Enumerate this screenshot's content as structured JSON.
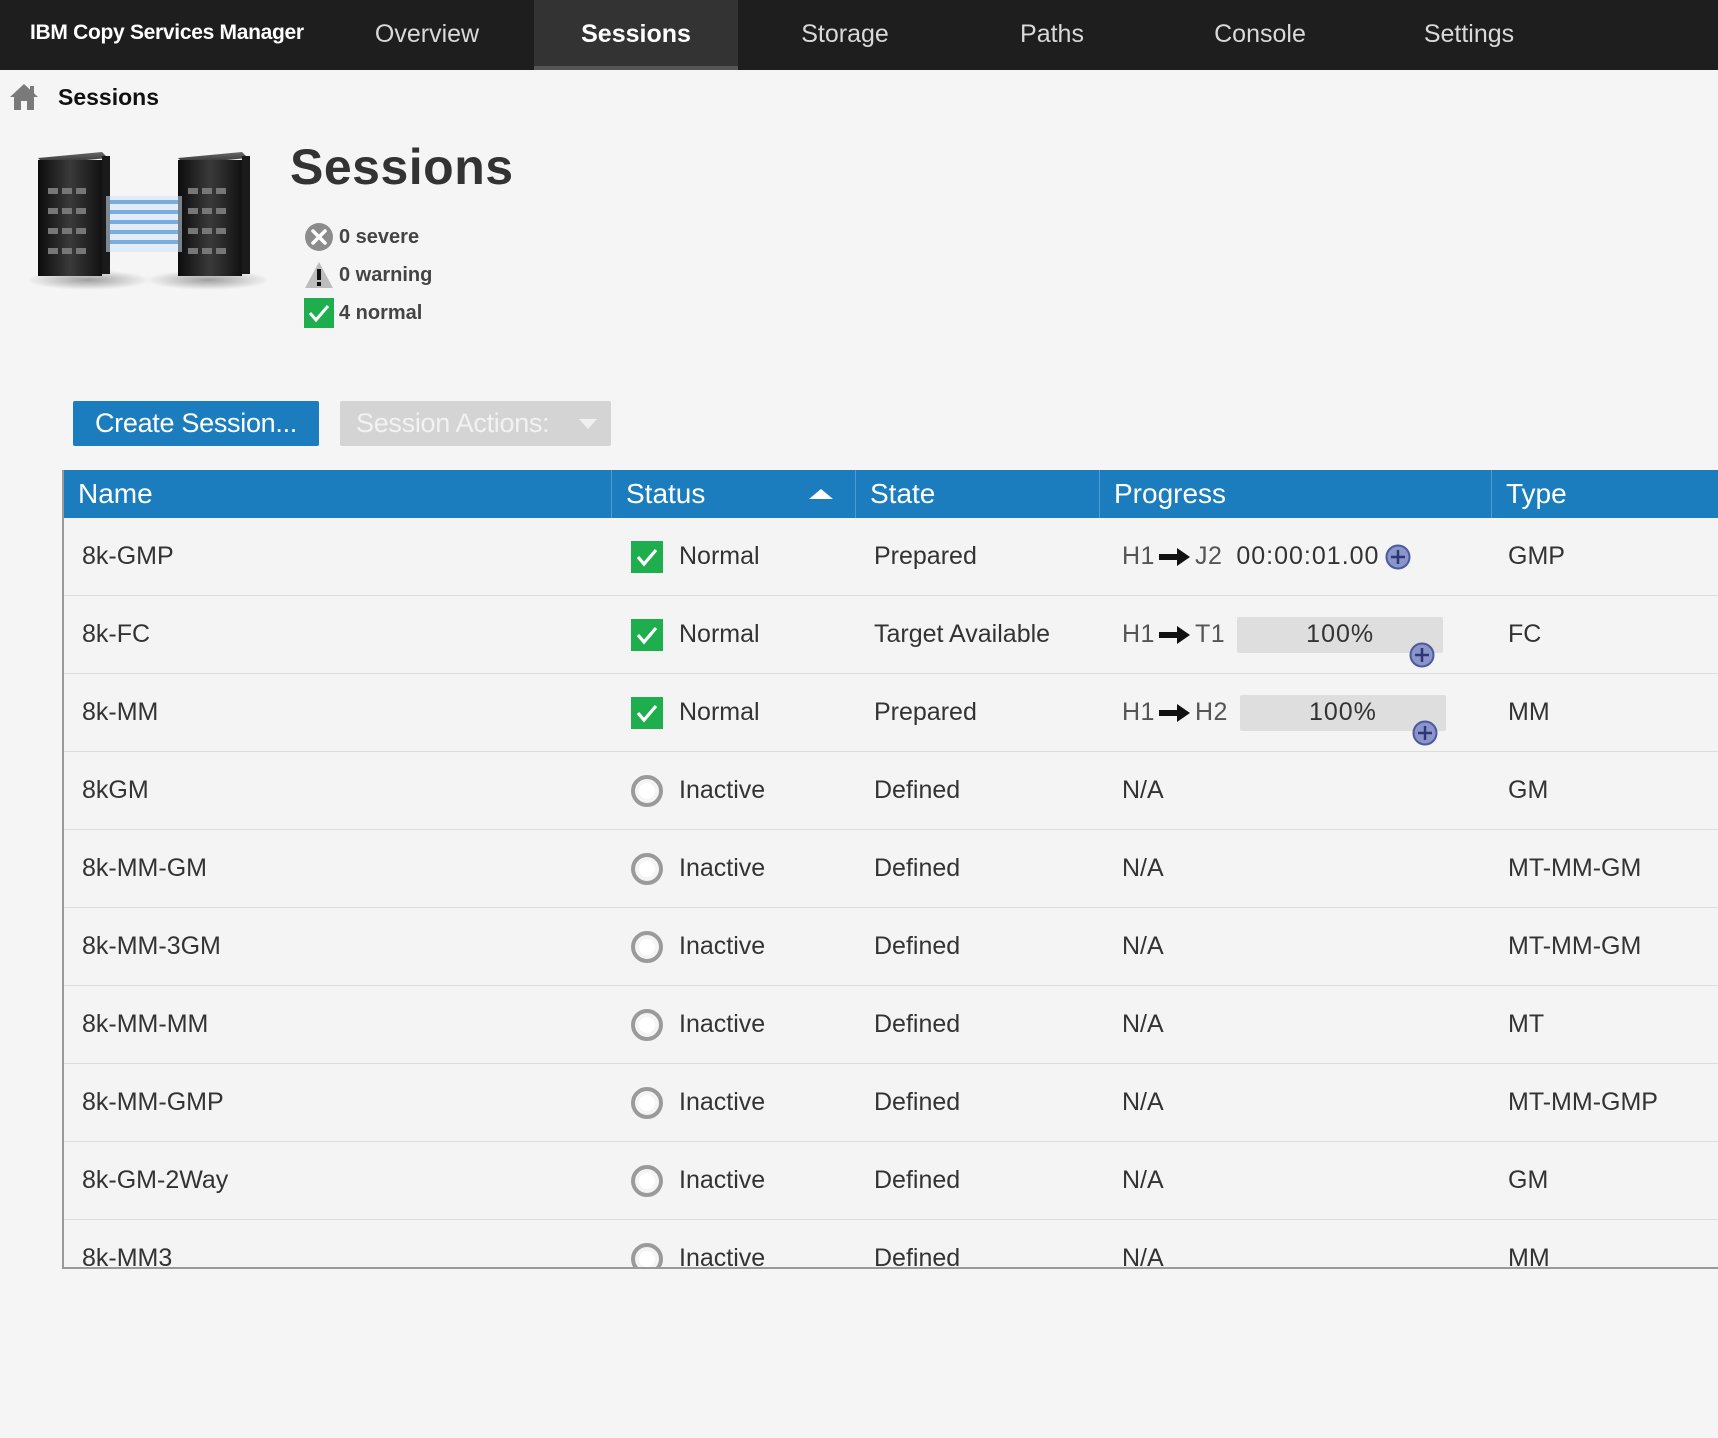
{
  "nav": {
    "brand": "IBM Copy Services Manager",
    "tabs": [
      {
        "label": "Overview"
      },
      {
        "label": "Sessions"
      },
      {
        "label": "Storage"
      },
      {
        "label": "Paths"
      },
      {
        "label": "Console"
      },
      {
        "label": "Settings"
      }
    ],
    "active_tab": "Sessions"
  },
  "breadcrumb": {
    "current": "Sessions"
  },
  "page": {
    "title": "Sessions",
    "summary": {
      "severe": "0 severe",
      "warning": "0 warning",
      "normal": "4 normal"
    }
  },
  "toolbar": {
    "create_label": "Create Session...",
    "actions_label": "Session Actions:"
  },
  "table": {
    "columns": [
      "Name",
      "Status",
      "State",
      "Progress",
      "Type"
    ],
    "sorted_column": "Status",
    "sort_direction": "ascending",
    "rows": [
      {
        "name": "8k-GMP",
        "status": "Normal",
        "state": "Prepared",
        "progress": {
          "kind": "time",
          "source": "H1",
          "target": "J2",
          "value": "00:00:01.00"
        },
        "type": "GMP"
      },
      {
        "name": "8k-FC",
        "status": "Normal",
        "state": "Target Available",
        "progress": {
          "kind": "percent",
          "source": "H1",
          "target": "T1",
          "value": "100%"
        },
        "type": "FC"
      },
      {
        "name": "8k-MM",
        "status": "Normal",
        "state": "Prepared",
        "progress": {
          "kind": "percent",
          "source": "H1",
          "target": "H2",
          "value": "100%"
        },
        "type": "MM"
      },
      {
        "name": "8kGM",
        "status": "Inactive",
        "state": "Defined",
        "progress": {
          "kind": "na",
          "value": "N/A"
        },
        "type": "GM"
      },
      {
        "name": "8k-MM-GM",
        "status": "Inactive",
        "state": "Defined",
        "progress": {
          "kind": "na",
          "value": "N/A"
        },
        "type": "MT-MM-GM"
      },
      {
        "name": "8k-MM-3GM",
        "status": "Inactive",
        "state": "Defined",
        "progress": {
          "kind": "na",
          "value": "N/A"
        },
        "type": "MT-MM-GM"
      },
      {
        "name": "8k-MM-MM",
        "status": "Inactive",
        "state": "Defined",
        "progress": {
          "kind": "na",
          "value": "N/A"
        },
        "type": "MT"
      },
      {
        "name": "8k-MM-GMP",
        "status": "Inactive",
        "state": "Defined",
        "progress": {
          "kind": "na",
          "value": "N/A"
        },
        "type": "MT-MM-GMP"
      },
      {
        "name": "8k-GM-2Way",
        "status": "Inactive",
        "state": "Defined",
        "progress": {
          "kind": "na",
          "value": "N/A"
        },
        "type": "GM"
      },
      {
        "name": "8k-MM3",
        "status": "Inactive",
        "state": "Defined",
        "progress": {
          "kind": "na",
          "value": "N/A"
        },
        "type": "MM"
      }
    ]
  },
  "colors": {
    "nav_bg": "#1e1e1e",
    "accent_blue": "#1b7dbd",
    "normal_green": "#1fae4e",
    "inactive_gray": "#9a9a9a",
    "progress_plus": "#5a6bb0"
  },
  "icons": {
    "home": "home-icon",
    "sessions_hero": "replication-servers-icon",
    "severe": "x-circle-icon",
    "warning": "warning-triangle-icon",
    "normal": "green-check-icon",
    "inactive": "inactive-circle-icon",
    "arrow": "right-arrow-icon",
    "expand": "plus-circle-icon",
    "sort": "sort-ascending-icon",
    "dropdown": "chevron-down-icon"
  }
}
